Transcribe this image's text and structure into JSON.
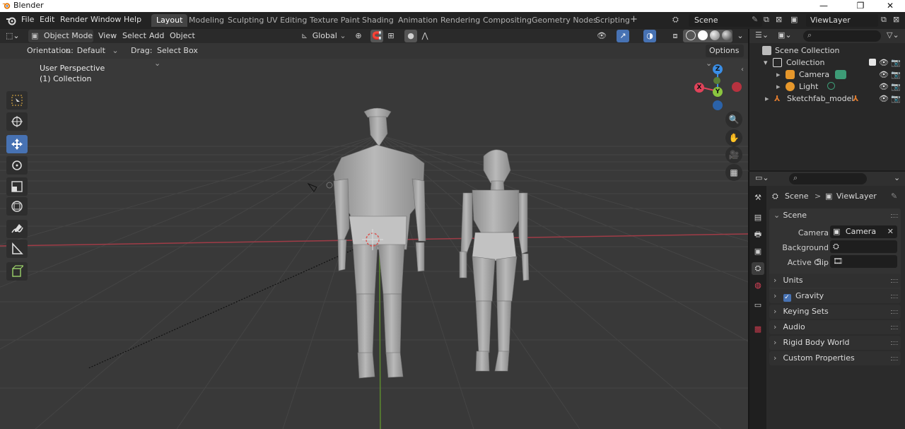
{
  "window": {
    "title": "Blender",
    "minimize": "—",
    "maximize": "❐",
    "close": "✕"
  },
  "menu": [
    "File",
    "Edit",
    "Render",
    "Window",
    "Help"
  ],
  "workspaces": [
    "Layout",
    "Modeling",
    "Sculpting",
    "UV Editing",
    "Texture Paint",
    "Shading",
    "Animation",
    "Rendering",
    "Compositing",
    "Geometry Nodes",
    "Scripting"
  ],
  "workspace_add": "+",
  "scene_name": "Scene",
  "view_layer_name": "ViewLayer",
  "viewport": {
    "mode": "Object Mode",
    "menus": [
      "View",
      "Select",
      "Add",
      "Object"
    ],
    "transform_orientation": "Global",
    "orientation_label": "Orientation:",
    "orientation_value": "Default",
    "drag_label": "Drag:",
    "drag_value": "Select Box",
    "options_label": "Options",
    "overlay_title": "User Perspective",
    "overlay_collection": "(1) Collection",
    "gizmo": {
      "x": "X",
      "y": "Y",
      "z": "Z"
    }
  },
  "outliner": {
    "root": "Scene Collection",
    "items": [
      {
        "label": "Collection"
      },
      {
        "label": "Camera"
      },
      {
        "label": "Light"
      },
      {
        "label": "Sketchfab_model"
      }
    ]
  },
  "properties": {
    "breadcrumb_scene": "Scene",
    "breadcrumb_separator": ">",
    "breadcrumb_layer": "ViewLayer",
    "section_scene": "Scene",
    "camera_label": "Camera",
    "camera_value": "Camera",
    "background_label": "Background S...",
    "active_clip_label": "Active Clip",
    "sections": [
      "Units",
      "Gravity",
      "Keying Sets",
      "Audio",
      "Rigid Body World",
      "Custom Properties"
    ],
    "gravity_checked": true
  },
  "colors": {
    "accent_blue": "#4772b3",
    "axis_x": "#e0435a",
    "axis_y": "#8bc53f",
    "axis_z": "#3a8ee6",
    "outliner_camera": "#3d9b76",
    "outliner_light": "#e6972b",
    "outliner_model": "#e07b2e"
  }
}
